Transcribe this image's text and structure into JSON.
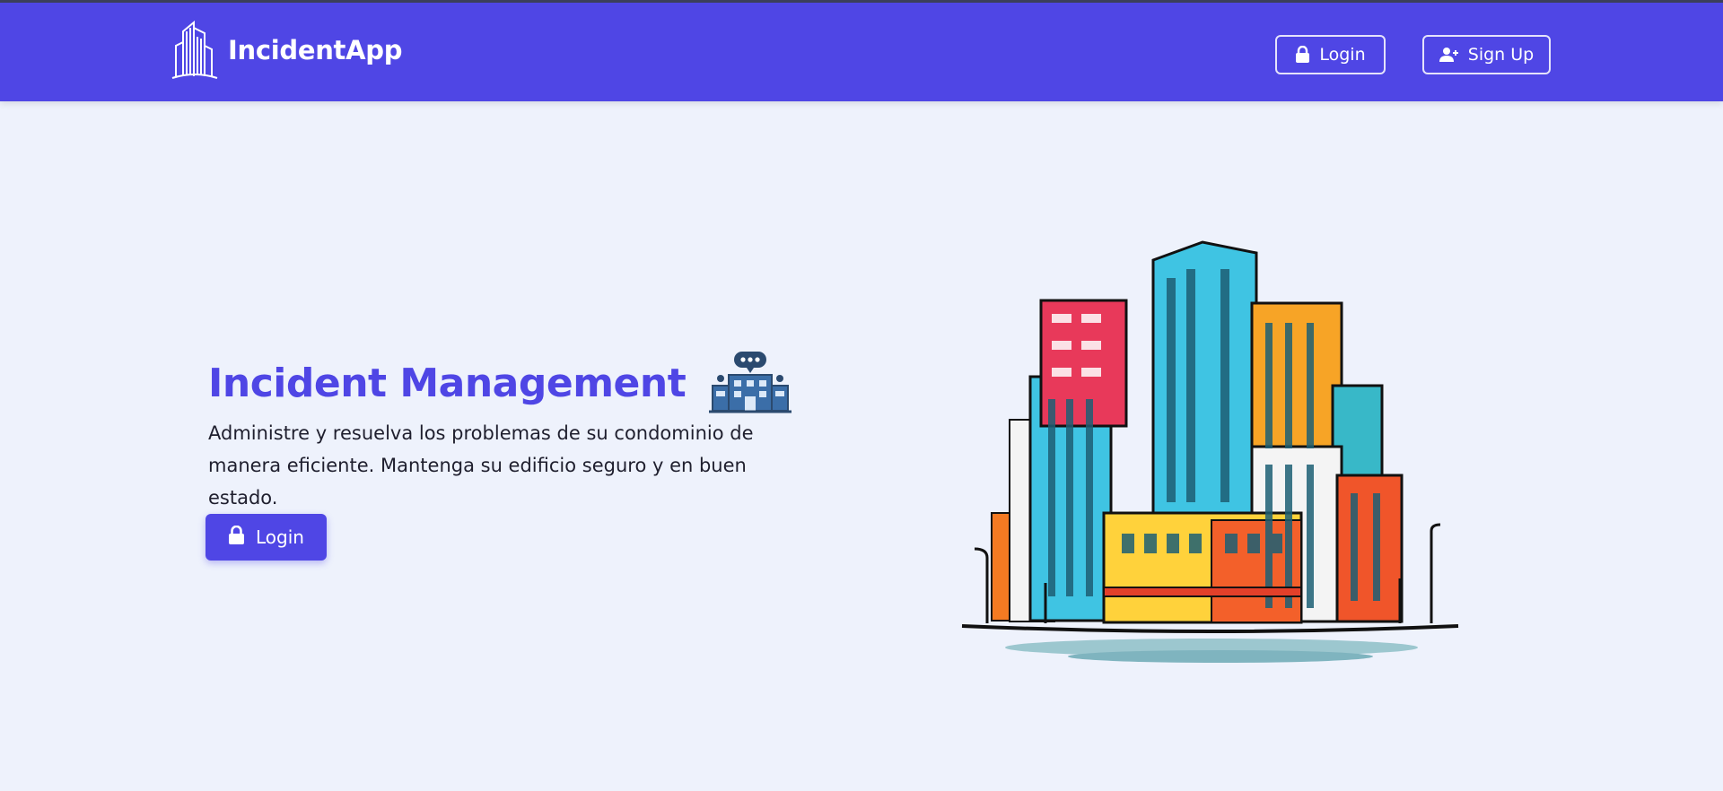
{
  "navbar": {
    "brand_name": "IncidentApp",
    "brand_icon": "building-logo-icon",
    "login_label": "Login",
    "login_icon": "lock-icon",
    "signup_label": "Sign Up",
    "signup_icon": "user-plus-icon"
  },
  "hero": {
    "title": "Incident Management",
    "title_icon": "building-chat-icon",
    "description": "Administre y resuelva los problemas de su condominio de manera eficiente. Mantenga su edificio seguro y en buen estado.",
    "login_label": "Login",
    "login_icon": "lock-icon",
    "illustration": "colorful-city-buildings-illustration"
  },
  "colors": {
    "primary": "#4f46e5",
    "background": "#eef2fc",
    "text": "#1f1f2e"
  }
}
